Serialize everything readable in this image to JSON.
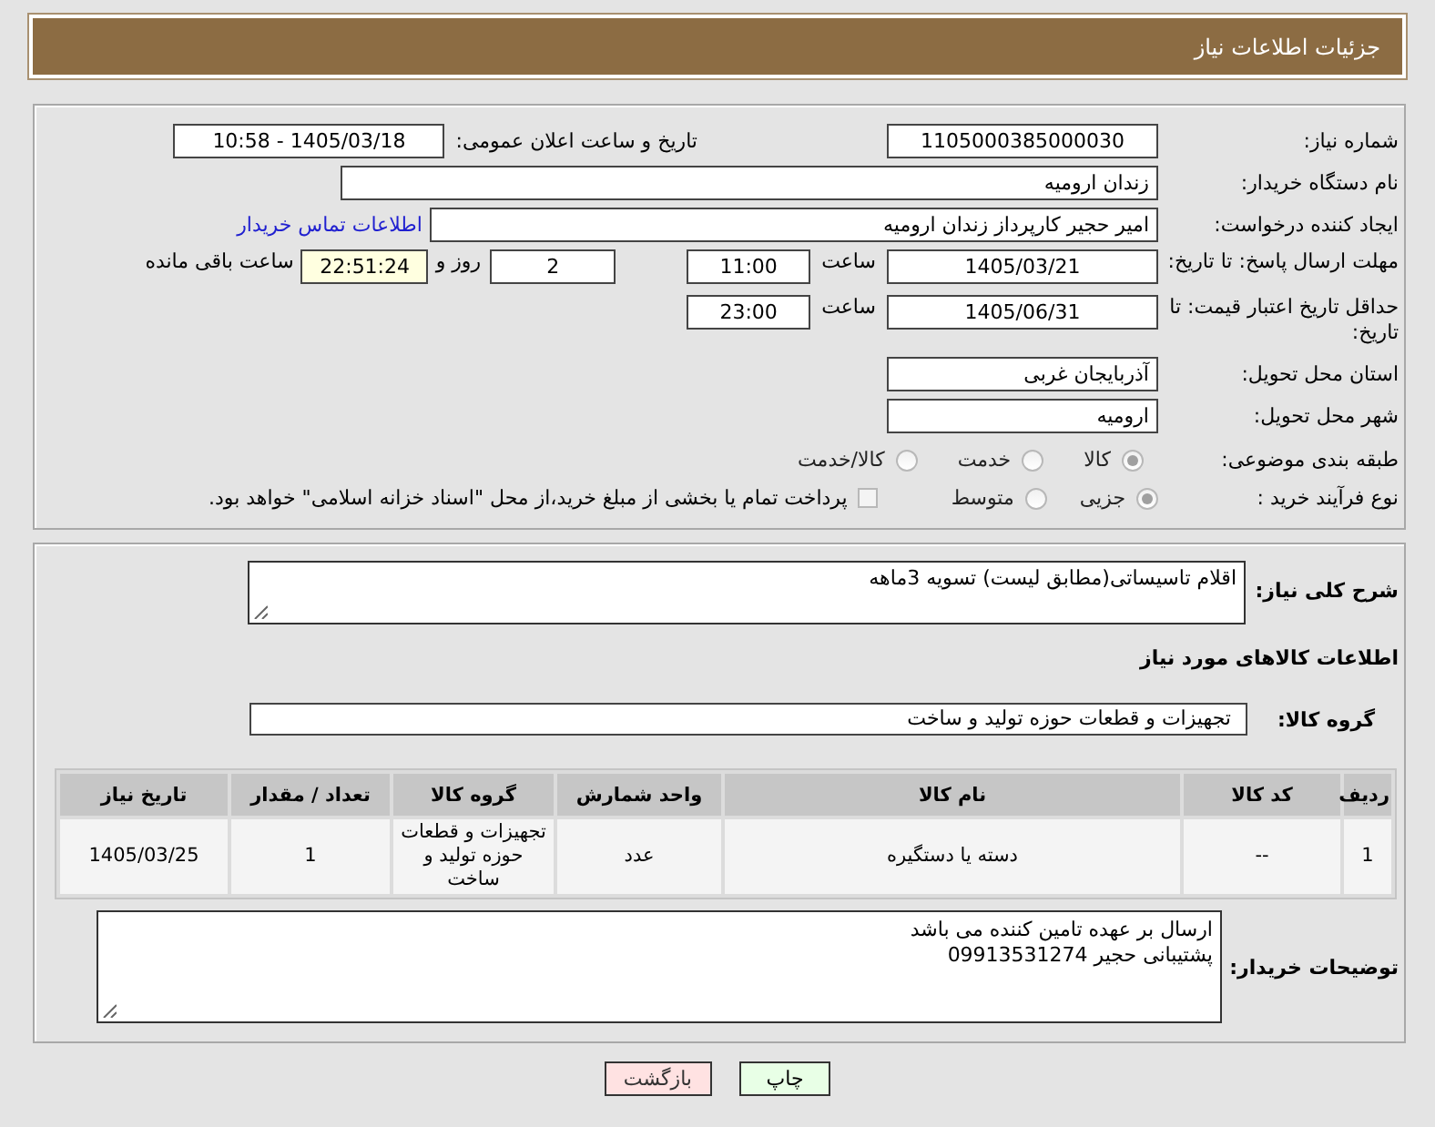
{
  "header": {
    "title": "جزئیات اطلاعات نیاز"
  },
  "details": {
    "need_number": {
      "label": "شماره نیاز:",
      "value": "1105000385000030"
    },
    "announce_datetime": {
      "label": "تاریخ و ساعت اعلان عمومی:",
      "value": "1405/03/18 - 10:58"
    },
    "buyer_org": {
      "label": "نام دستگاه خریدار:",
      "value": "زندان ارومیه"
    },
    "requester": {
      "label": "ایجاد کننده درخواست:",
      "value": "امیر حجیر کارپرداز زندان ارومیه",
      "link": "اطلاعات تماس خریدار"
    },
    "response_deadline": {
      "label": "مهلت ارسال پاسخ: تا تاریخ:",
      "date": "1405/03/21",
      "time_label": "ساعت",
      "time": "11:00",
      "days": "2",
      "days_label": "روز و",
      "remaining": "22:51:24",
      "remaining_label": "ساعت باقی مانده"
    },
    "price_validity": {
      "label": "حداقل تاریخ اعتبار قیمت: تا تاریخ:",
      "date": "1405/06/31",
      "time_label": "ساعت",
      "time": "23:00"
    },
    "province": {
      "label": "استان محل تحویل:",
      "value": "آذربایجان غربی"
    },
    "city": {
      "label": "شهر محل تحویل:",
      "value": "ارومیه"
    },
    "category": {
      "label": "طبقه بندی موضوعی:",
      "options": [
        {
          "label": "کالا",
          "selected": true
        },
        {
          "label": "خدمت",
          "selected": false
        },
        {
          "label": "کالا/خدمت",
          "selected": false
        }
      ]
    },
    "process": {
      "label": "نوع فرآیند خرید :",
      "options": [
        {
          "label": "جزیی",
          "selected": true
        },
        {
          "label": "متوسط",
          "selected": false
        }
      ],
      "payment_note": {
        "checked": false,
        "text": "پرداخت تمام یا بخشی از مبلغ خرید،از محل \"اسناد خزانه اسلامی\" خواهد بود."
      }
    }
  },
  "goods": {
    "description": {
      "label": "شرح کلی نیاز:",
      "value": "اقلام تاسیساتی(مطابق لیست) تسویه 3ماهه"
    },
    "section_title": "اطلاعات کالاهای مورد نیاز",
    "group": {
      "label": "گروه کالا:",
      "value": "تجهیزات و قطعات حوزه تولید و ساخت"
    },
    "table": {
      "columns": [
        "ردیف",
        "کد کالا",
        "نام کالا",
        "واحد شمارش",
        "گروه کالا",
        "تعداد / مقدار",
        "تاریخ نیاز"
      ],
      "rows": [
        [
          "1",
          "--",
          "دسته یا دستگیره",
          "عدد",
          "تجهیزات و قطعات حوزه تولید و ساخت",
          "1",
          "1405/03/25"
        ]
      ]
    },
    "buyer_notes": {
      "label": "توضیحات خریدار:",
      "lines": [
        "ارسال بر عهده تامین کننده می باشد",
        "پشتیبانی حجیر 09913531274"
      ]
    }
  },
  "buttons": [
    {
      "label": "چاپ",
      "kind": "print"
    },
    {
      "label": "بازگشت",
      "kind": "back"
    }
  ]
}
